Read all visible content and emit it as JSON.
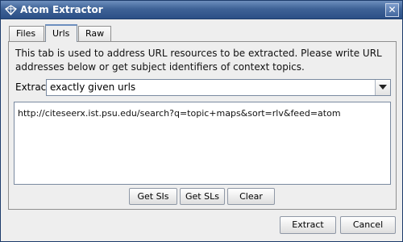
{
  "window": {
    "title": "Atom Extractor",
    "close_label": "✕"
  },
  "tabs": [
    {
      "label": "Files",
      "active": false
    },
    {
      "label": "Urls",
      "active": true
    },
    {
      "label": "Raw",
      "active": false
    }
  ],
  "urls_tab": {
    "description": "This tab is used to address URL resources to be extracted. Please write URL addresses below or get subject identifiers of context topics.",
    "extract_label": "Extract",
    "extract_mode": "exactly given urls",
    "url_text": "http://citeseerx.ist.psu.edu/search?q=topic+maps&sort=rlv&feed=atom",
    "buttons": {
      "get_sis": "Get SIs",
      "get_sls": "Get SLs",
      "clear": "Clear"
    }
  },
  "footer": {
    "extract": "Extract",
    "cancel": "Cancel"
  },
  "colors": {
    "titlebar": "#3f6397",
    "window_bg": "#eeeeee",
    "accent": "#6d8fbf"
  }
}
